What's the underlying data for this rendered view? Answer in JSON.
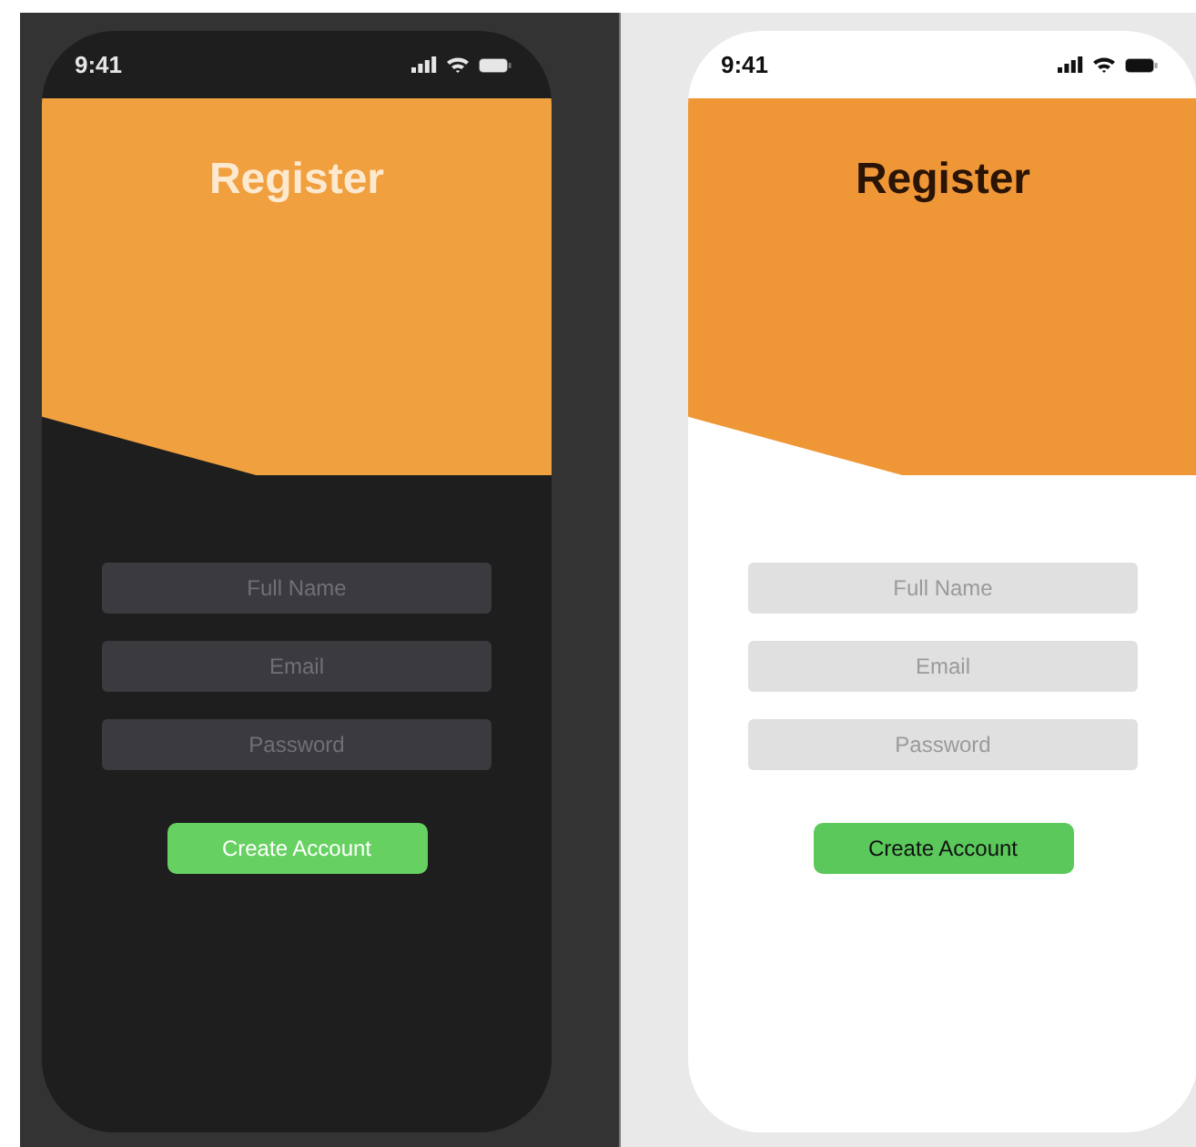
{
  "phones": [
    {
      "kind": "dark",
      "status_bar": {
        "time": "9:41"
      },
      "title": "Register",
      "fields": [
        {
          "placeholder": "Full Name"
        },
        {
          "placeholder": "Email"
        },
        {
          "placeholder": "Password"
        }
      ],
      "button": "Create Account"
    },
    {
      "kind": "light",
      "status_bar": {
        "time": "9:41"
      },
      "title": "Register",
      "fields": [
        {
          "placeholder": "Full Name"
        },
        {
          "placeholder": "Email"
        },
        {
          "placeholder": "Password"
        }
      ],
      "button": "Create Account"
    }
  ]
}
